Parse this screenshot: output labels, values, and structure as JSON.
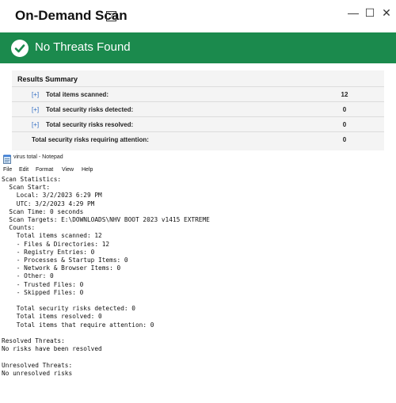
{
  "scan_window": {
    "title": "On-Demand Scan",
    "help_icon": "?",
    "controls": {
      "minimize": "—",
      "maximize": "☐",
      "close": "✕"
    },
    "status_banner": {
      "icon": "check-circle-icon",
      "text": "No Threats Found",
      "color": "#1b8a4d"
    },
    "results_summary": {
      "heading": "Results Summary",
      "rows": [
        {
          "expand": "[+]",
          "label": "Total items scanned:",
          "value": "12"
        },
        {
          "expand": "[+]",
          "label": "Total security risks detected:",
          "value": "0"
        },
        {
          "expand": "[+]",
          "label": "Total security risks resolved:",
          "value": "0"
        },
        {
          "expand": "",
          "label": "Total security risks requiring attention:",
          "value": "0"
        }
      ]
    }
  },
  "notepad": {
    "title": "virus total - Notepad",
    "menu": [
      "File",
      "Edit",
      "Format",
      "View",
      "Help"
    ],
    "content": "Scan Statistics:\n  Scan Start:\n    Local: 3/2/2023 6:29 PM\n    UTC: 3/2/2023 4:29 PM\n  Scan Time: 0 seconds\n  Scan Targets: E:\\DOWNLOADS\\NHV BOOT 2023 v1415 EXTREME\n  Counts:\n    Total items scanned: 12\n    - Files & Directories: 12\n    - Registry Entries: 0\n    - Processes & Startup Items: 0\n    - Network & Browser Items: 0\n    - Other: 0\n    - Trusted Files: 0\n    - Skipped Files: 0\n\n    Total security risks detected: 0\n    Total items resolved: 0\n    Total items that require attention: 0\n\nResolved Threats:\nNo risks have been resolved\n\nUnresolved Threats:\nNo unresolved risks"
  }
}
